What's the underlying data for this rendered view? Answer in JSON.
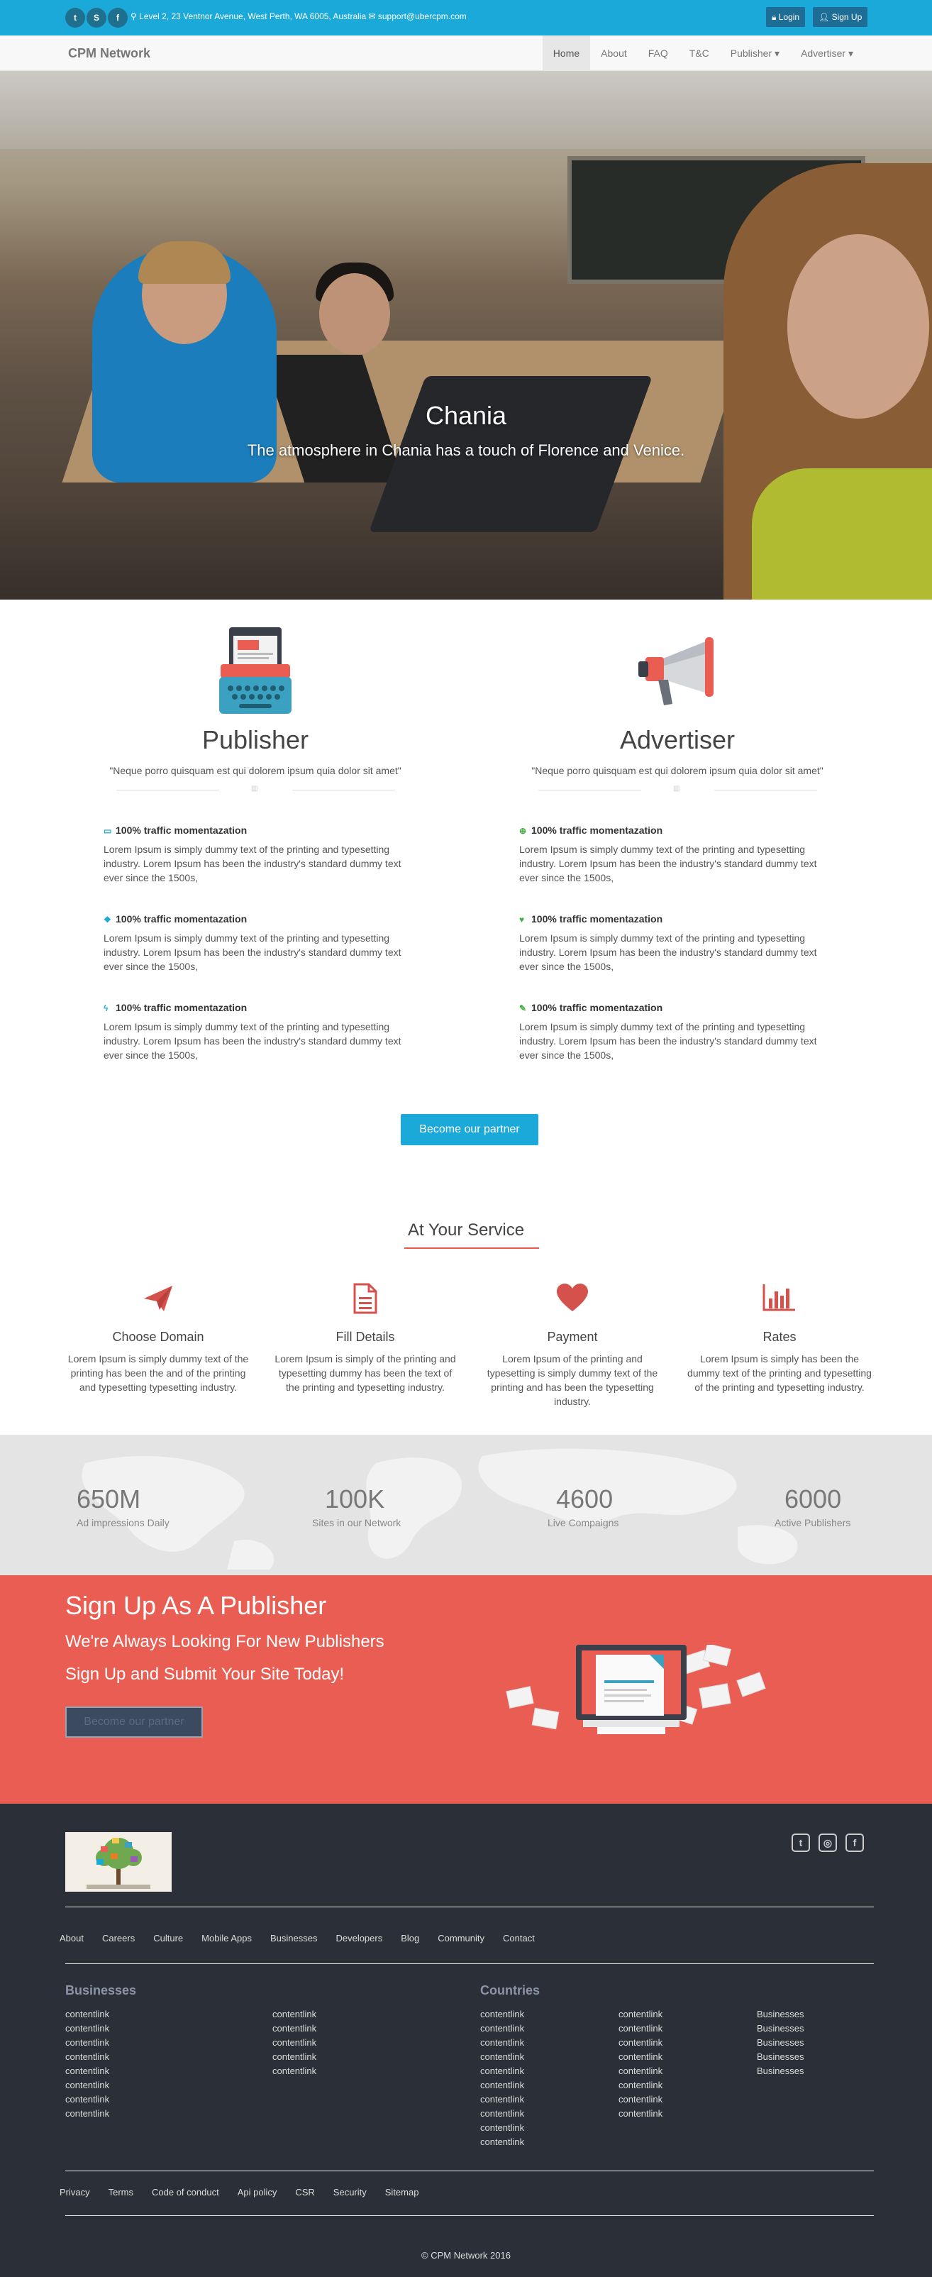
{
  "topbar": {
    "social": [
      {
        "icon": "twitter-icon",
        "glyph": "t"
      },
      {
        "icon": "skype-icon",
        "glyph": "S"
      },
      {
        "icon": "facebook-icon",
        "glyph": "f"
      }
    ],
    "address": "Level 2, 23 Ventnor Avenue, West Perth, WA 6005, Australia",
    "email": "support@ubercpm.com",
    "login_label": "Login",
    "signup_label": "Sign Up"
  },
  "navbar": {
    "brand": "CPM Network",
    "items": [
      "Home",
      "About",
      "FAQ",
      "T&C",
      "Publisher ▾",
      "Advertiser ▾"
    ],
    "active": "Home"
  },
  "hero": {
    "title": "Chania",
    "subtitle": "The atmosphere in Chania has a touch of Florence and Venice.",
    "slides": 4,
    "active_slide": 2
  },
  "publisher": {
    "title": "Publisher",
    "quote": "\"Neque porro quisquam est qui dolorem ipsum quia dolor sit amet\"",
    "features": [
      {
        "icon": "monitor-icon",
        "glyph": "▭",
        "title": "100% traffic momentazation",
        "text": "Lorem Ipsum is simply dummy text of the printing and typesetting industry. Lorem Ipsum has been the industry's standard dummy text ever since the 1500s,"
      },
      {
        "icon": "gift-icon",
        "glyph": "❖",
        "title": "100% traffic momentazation",
        "text": "Lorem Ipsum is simply dummy text of the printing and typesetting industry. Lorem Ipsum has been the industry's standard dummy text ever since the 1500s,"
      },
      {
        "icon": "bolt-icon",
        "glyph": "ϟ",
        "title": "100% traffic momentazation",
        "text": "Lorem Ipsum is simply dummy text of the printing and typesetting industry. Lorem Ipsum has been the industry's standard dummy text ever since the 1500s,"
      }
    ]
  },
  "advertiser": {
    "title": "Advertiser",
    "quote": "\"Neque porro quisquam est qui dolorem ipsum quia dolor sit amet\"",
    "features": [
      {
        "icon": "globe-icon",
        "glyph": "⊕",
        "title": "100% traffic momentazation",
        "text": "Lorem Ipsum is simply dummy text of the printing and typesetting industry. Lorem Ipsum has been the industry's standard dummy text ever since the 1500s,"
      },
      {
        "icon": "bulb-icon",
        "glyph": "♥",
        "title": "100% traffic momentazation",
        "text": "Lorem Ipsum is simply dummy text of the printing and typesetting industry. Lorem Ipsum has been the industry's standard dummy text ever since the 1500s,"
      },
      {
        "icon": "wrench-icon",
        "glyph": "✎",
        "title": "100% traffic momentazation",
        "text": "Lorem Ipsum is simply dummy text of the printing and typesetting industry. Lorem Ipsum has been the industry's standard dummy text ever since the 1500s,"
      }
    ]
  },
  "partner_button": "Become our partner",
  "service": {
    "title": "At Your Service",
    "items": [
      {
        "icon": "paper-plane-icon",
        "glyph": "➤",
        "title": "Choose Domain",
        "text": "Lorem Ipsum is simply dummy text of the printing has been the and of the printing and typesetting typesetting industry."
      },
      {
        "icon": "document-icon",
        "glyph": "▤",
        "title": "Fill Details",
        "text": "Lorem Ipsum is simply of the printing and typesetting dummy has been the text of the printing and typesetting industry."
      },
      {
        "icon": "heart-icon",
        "glyph": "♥",
        "title": "Payment",
        "text": "Lorem Ipsum of the printing and typesetting is simply dummy text of the printing and has been the typesetting industry."
      },
      {
        "icon": "bar-chart-icon",
        "glyph": "▥",
        "title": "Rates",
        "text": "Lorem Ipsum is simply has been the dummy text of the printing and typesetting of the printing and typesetting industry."
      }
    ]
  },
  "stats": [
    {
      "value": "650M",
      "label": "Ad impressions Daily"
    },
    {
      "value": "100K",
      "label": "Sites in our Network"
    },
    {
      "value": "4600",
      "label": "Live Compaigns"
    },
    {
      "value": "6000",
      "label": "Active Publishers"
    }
  ],
  "signup": {
    "title": "Sign Up As A Publisher",
    "line1": "We're Always Looking For New Publishers",
    "line2": "Sign Up and Submit Your Site Today!",
    "button": "Become our partner"
  },
  "footer": {
    "social": [
      {
        "icon": "twitter-icon",
        "glyph": "t"
      },
      {
        "icon": "instagram-icon",
        "glyph": "◎"
      },
      {
        "icon": "facebook-icon",
        "glyph": "f"
      }
    ],
    "links": [
      "About",
      "Careers",
      "Culture",
      "Mobile Apps",
      "Businesses",
      "Developers",
      "Blog",
      "Community",
      "Contact"
    ],
    "businesses_title": "Businesses",
    "countries_title": "Countries",
    "biz_col1": [
      "contentlink",
      "contentlink",
      "contentlink",
      "contentlink",
      "contentlink",
      "contentlink",
      "contentlink",
      "contentlink"
    ],
    "biz_col2": [
      "contentlink",
      "contentlink",
      "contentlink",
      "contentlink",
      "contentlink"
    ],
    "country_col1": [
      "contentlink",
      "contentlink",
      "contentlink",
      "contentlink",
      "contentlink",
      "contentlink",
      "contentlink",
      "contentlink",
      "contentlink",
      "contentlink"
    ],
    "country_col2": [
      "contentlink",
      "contentlink",
      "contentlink",
      "contentlink",
      "contentlink",
      "contentlink",
      "contentlink",
      "contentlink"
    ],
    "country_col3": [
      "Businesses",
      "Businesses",
      "Businesses",
      "Businesses",
      "Businesses"
    ],
    "bottom_links": [
      "Privacy",
      "Terms",
      "Code of conduct",
      "Api policy",
      "CSR",
      "Security",
      "Sitemap"
    ],
    "copyright": "© CPM Network 2016"
  },
  "colors": {
    "topbar": "#1aa9d8",
    "accent": "#e95d52",
    "footer": "#2b2f38"
  }
}
